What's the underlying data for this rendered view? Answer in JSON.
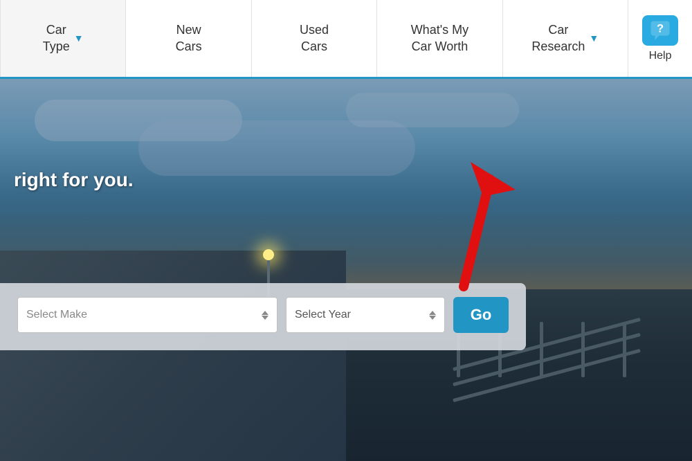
{
  "navbar": {
    "items": [
      {
        "id": "car-type",
        "label": "Car\nType",
        "has_dropdown": true
      },
      {
        "id": "new-cars",
        "label": "New\nCars",
        "has_dropdown": false
      },
      {
        "id": "used-cars",
        "label": "Used\nCars",
        "has_dropdown": false
      },
      {
        "id": "whats-my-car-worth",
        "label": "What's My\nCar Worth",
        "has_dropdown": false
      },
      {
        "id": "car-research",
        "label": "Car\nResearch",
        "has_dropdown": true
      }
    ],
    "help_label": "Help",
    "dropdown_arrow": "▼"
  },
  "hero": {
    "tagline": "right for you."
  },
  "search": {
    "make_placeholder": "Select Make",
    "year_placeholder": "Select Year",
    "go_label": "Go"
  },
  "colors": {
    "accent_blue": "#2196c4",
    "nav_border": "#2196c4",
    "help_bg": "#29abe2",
    "red_arrow": "#e01010"
  }
}
